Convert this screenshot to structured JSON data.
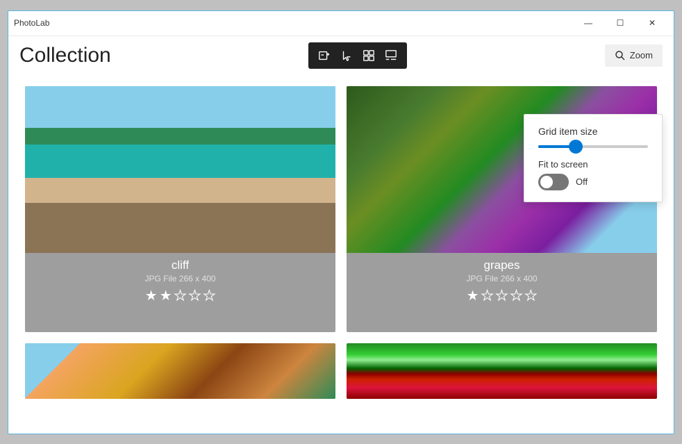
{
  "app": {
    "title": "PhotoLab"
  },
  "titlebar": {
    "minimize_label": "—",
    "maximize_label": "☐",
    "close_label": "✕"
  },
  "toolbar": {
    "page_title": "Collection",
    "zoom_button_label": "Zoom",
    "toolbar_icons": [
      {
        "name": "add-icon",
        "symbol": "⊞"
      },
      {
        "name": "select-icon",
        "symbol": "↖"
      },
      {
        "name": "grid-icon",
        "symbol": "⊟"
      },
      {
        "name": "layout-icon",
        "symbol": "⊡"
      }
    ]
  },
  "zoom_panel": {
    "title": "Grid item size",
    "slider_value": 30,
    "fit_to_screen_label": "Fit to screen",
    "toggle_state": "Off"
  },
  "photos": [
    {
      "id": "cliff",
      "name": "cliff",
      "meta": "JPG File   266 x 400",
      "rating": 2,
      "max_rating": 5
    },
    {
      "id": "grapes",
      "name": "grapes",
      "meta": "JPG File   266 x 400",
      "rating": 1,
      "max_rating": 5
    },
    {
      "id": "bottom-left",
      "name": "",
      "meta": "",
      "rating": 0,
      "max_rating": 0,
      "partial": true
    },
    {
      "id": "bottom-right",
      "name": "",
      "meta": "",
      "rating": 0,
      "max_rating": 0,
      "partial": true
    }
  ]
}
